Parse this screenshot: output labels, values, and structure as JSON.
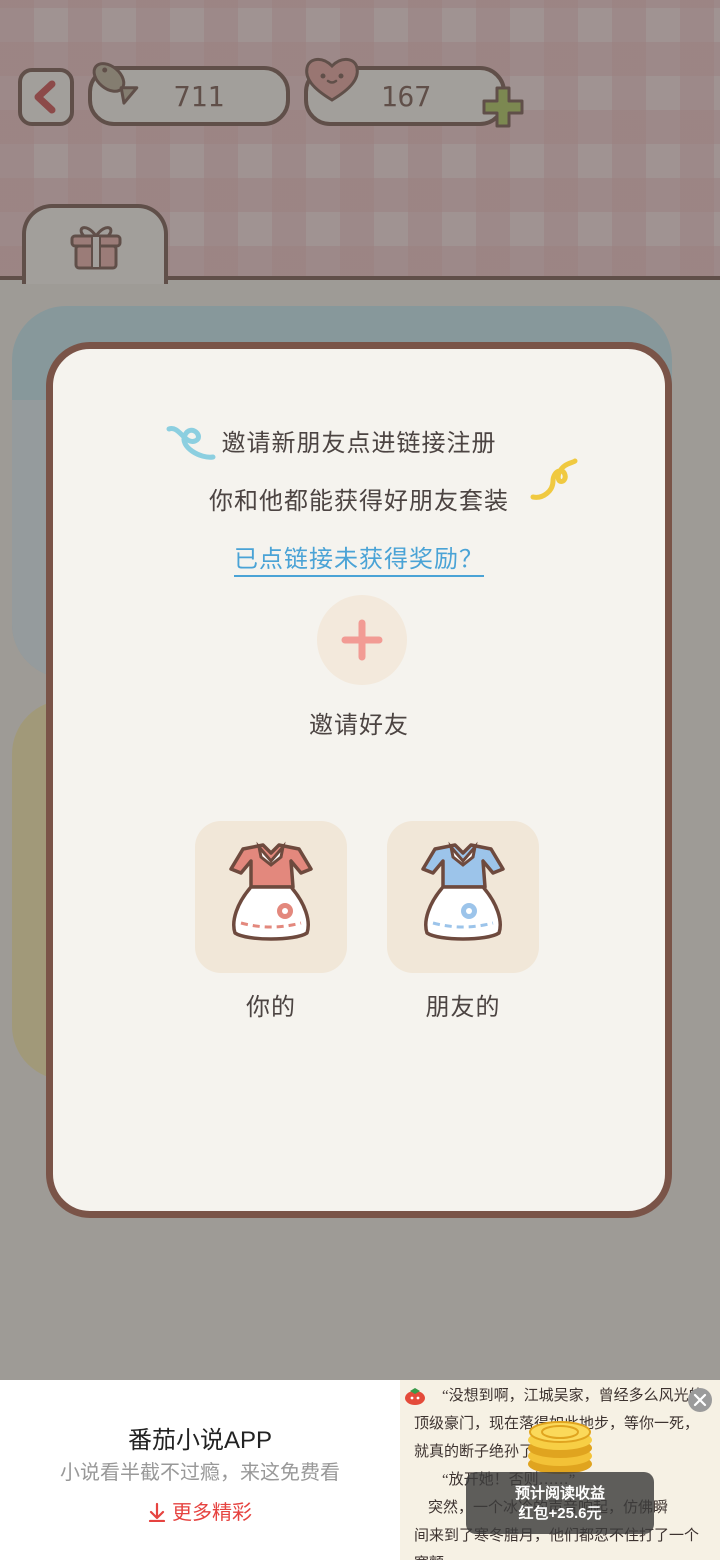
{
  "top_bar": {
    "fish_count": "711",
    "heart_count": "167"
  },
  "invite_modal": {
    "line1": "邀请新朋友点进链接注册",
    "line2": "你和他都能获得好朋友套装",
    "help_link": "已点链接未获得奖励？",
    "invite_label": "邀请好友",
    "mine_label": "你的",
    "friend_label": "朋友的"
  },
  "ad_banner": {
    "title": "番茄小说APP",
    "subtitle": "小说看半截不过瘾，来这免费看",
    "more_label": "更多精彩",
    "preview_lines": [
      "“没想到啊，江城吴家，曾经多么风光的",
      "顶级豪门，现在落得如此地步，等你一死，",
      "就真的断子绝孙了……”",
      "“放开她！否则……”",
      "突然，一个冰冷的声音响起，仿佛瞬",
      "间来到了寒冬腊月，他们都忍不住打了一个",
      "寒颤。"
    ],
    "reward_title": "预计阅读收益",
    "reward_value": "红包+25.6元"
  },
  "colors": {
    "accent_brown": "#7a5448",
    "link_blue": "#4aa3d6",
    "plus_pink": "#f29b94",
    "outfit_mine": "#e3887d",
    "outfit_friend": "#9cc4ea",
    "ad_red": "#e64340"
  },
  "icons": [
    "back-arrow-icon",
    "fish-icon",
    "heart-icon",
    "plus-icon",
    "gift-icon",
    "dress-icon",
    "download-icon",
    "close-icon",
    "coin-icon"
  ]
}
